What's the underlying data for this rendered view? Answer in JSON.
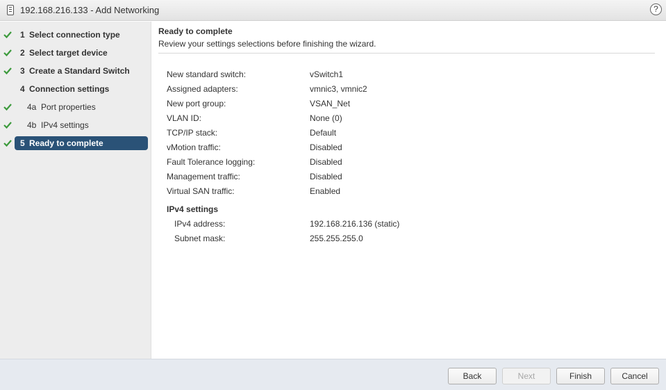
{
  "window": {
    "title": "192.168.216.133 - Add Networking",
    "help_label": "?"
  },
  "steps": [
    {
      "num": "1",
      "label": "Select connection type",
      "done": true,
      "active": false
    },
    {
      "num": "2",
      "label": "Select target device",
      "done": true,
      "active": false
    },
    {
      "num": "3",
      "label": "Create a Standard Switch",
      "done": true,
      "active": false
    },
    {
      "num": "4",
      "label": "Connection settings",
      "done": false,
      "active": false
    },
    {
      "num": "4a",
      "label": "Port properties",
      "done": true,
      "active": false
    },
    {
      "num": "4b",
      "label": "IPv4 settings",
      "done": true,
      "active": false
    },
    {
      "num": "5",
      "label": "Ready to complete",
      "done": true,
      "active": true
    }
  ],
  "main": {
    "title": "Ready to complete",
    "subtitle": "Review your settings selections before finishing the wizard.",
    "settings": [
      {
        "label": "New standard switch:",
        "value": "vSwitch1"
      },
      {
        "label": "Assigned adapters:",
        "value": "vmnic3, vmnic2"
      },
      {
        "label": "New port group:",
        "value": "VSAN_Net"
      },
      {
        "label": "VLAN ID:",
        "value": "None (0)"
      },
      {
        "label": "TCP/IP stack:",
        "value": "Default"
      },
      {
        "label": "vMotion traffic:",
        "value": "Disabled"
      },
      {
        "label": "Fault Tolerance logging:",
        "value": "Disabled"
      },
      {
        "label": "Management traffic:",
        "value": "Disabled"
      },
      {
        "label": "Virtual SAN traffic:",
        "value": "Enabled"
      }
    ],
    "ipv4": {
      "title": "IPv4 settings",
      "address_label": "IPv4 address:",
      "address_value": "192.168.216.136 (static)",
      "mask_label": "Subnet mask:",
      "mask_value": "255.255.255.0"
    }
  },
  "footer": {
    "back": "Back",
    "next": "Next",
    "finish": "Finish",
    "cancel": "Cancel"
  },
  "colors": {
    "active_step": "#2a5277",
    "check": "#3c9a3c",
    "footer_bg": "#e6eaf0"
  }
}
